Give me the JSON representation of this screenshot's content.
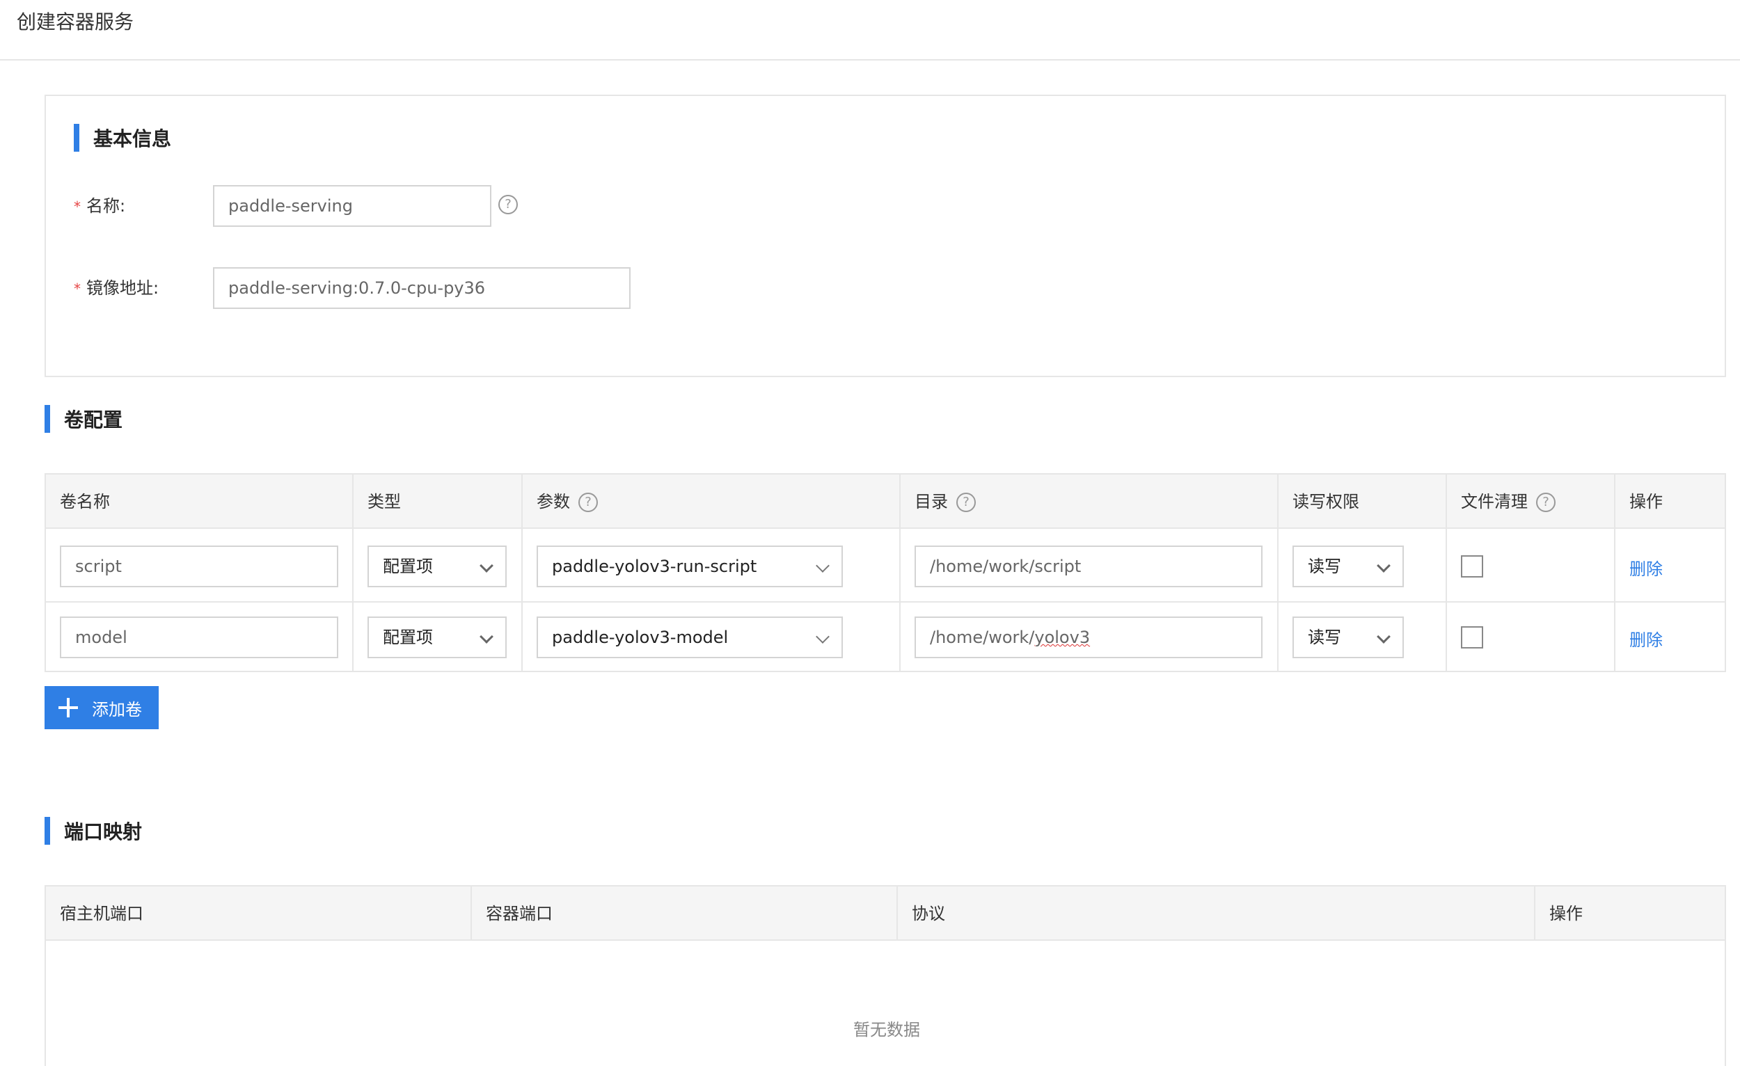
{
  "page": {
    "title": "创建容器服务"
  },
  "basic": {
    "title": "基本信息",
    "required_mark": "*",
    "name_label": "名称:",
    "name_value": "paddle-serving",
    "image_label": "镜像地址:",
    "image_value": "paddle-serving:0.7.0-cpu-py36",
    "help_glyph": "?"
  },
  "volume": {
    "title": "卷配置",
    "columns": [
      "卷名称",
      "类型",
      "参数",
      "目录",
      "读写权限",
      "文件清理",
      "操作"
    ],
    "rows": [
      {
        "name": "script",
        "type": "配置项",
        "param": "paddle-yolov3-run-script",
        "dir": "/home/work/script",
        "perm": "读写",
        "clean": false,
        "action": "删除"
      },
      {
        "name": "model",
        "type": "配置项",
        "param": "paddle-yolov3-model",
        "dir_prefix": "/home/work/",
        "dir_suffix": "yolov3",
        "perm": "读写",
        "clean": false,
        "action": "删除"
      }
    ],
    "add_label": "添加卷"
  },
  "port": {
    "title": "端口映射",
    "columns": [
      "宿主机端口",
      "容器端口",
      "协议",
      "操作"
    ],
    "empty_text": "暂无数据"
  },
  "colors": {
    "accent": "#2f7fe5",
    "required": "#e64545",
    "border": "#e6e6e6",
    "header_bg": "#f5f5f5"
  }
}
